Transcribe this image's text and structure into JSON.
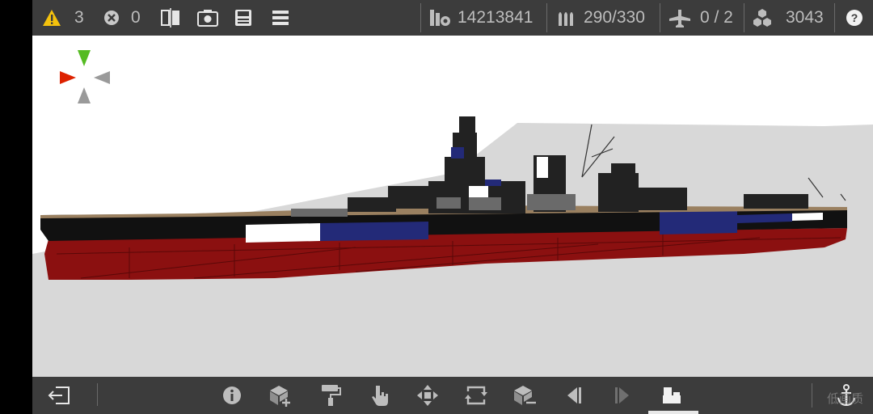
{
  "toolbar": {
    "warning_count": "3",
    "error_count": "0",
    "cost": "14213841",
    "ammo": "290/330",
    "aircraft": "0 / 2",
    "parts": "3043"
  },
  "watermark": "低画质",
  "colors": {
    "bar_bg": "#3c3c3c",
    "hull_red": "#8b1010",
    "navy": "#232a78",
    "warning": "#f4c20d"
  }
}
